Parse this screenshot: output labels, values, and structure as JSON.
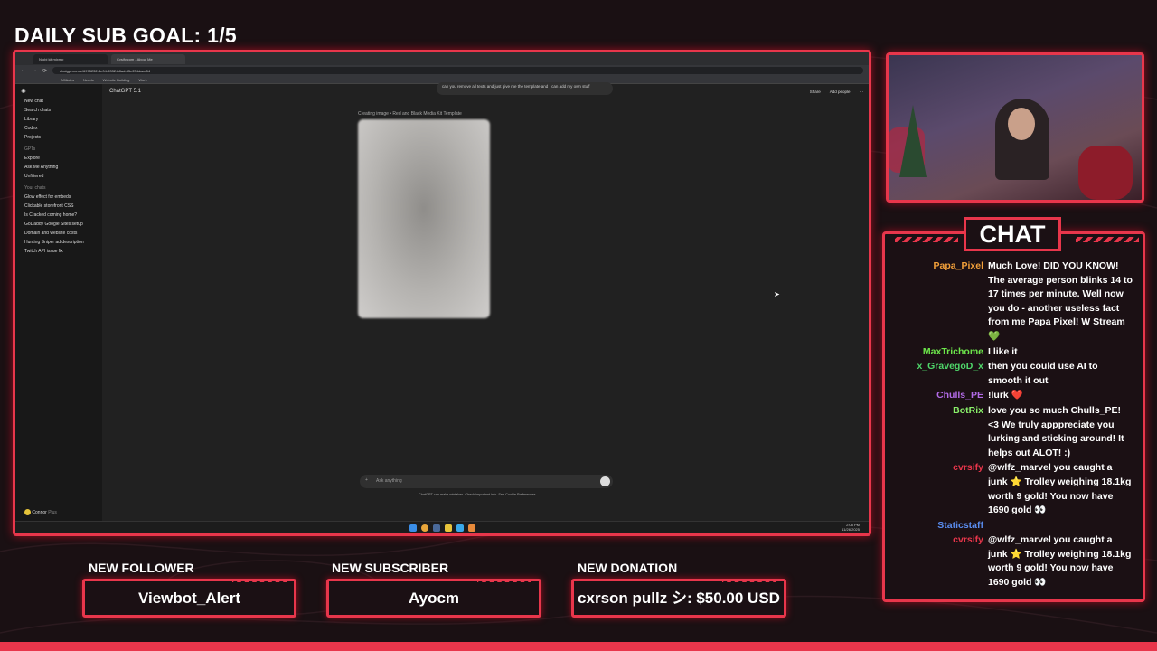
{
  "overlay": {
    "goal_text": "DAILY SUB GOAL: 1/5",
    "accent_color": "#e8364b",
    "chat_title": "CHAT"
  },
  "browser": {
    "tabs": [
      "Ntobi kit mixmp",
      "Cvsify.com - About Me"
    ],
    "url": "chatgpt.com/c/6975232-3e04-8332-b8ad-d5e234dace54",
    "bookmarks": [
      "Affiliates",
      "Needs",
      "Website Building",
      "Work"
    ]
  },
  "chatgpt": {
    "model": "ChatGPT 5.1",
    "share_label": "Share",
    "add_people_label": "Add people",
    "nav": [
      "New chat",
      "Search chats",
      "Library",
      "Codex",
      "Projects"
    ],
    "gpts_label": "GPTs",
    "gpts": [
      "Explore",
      "Ask Me Anything",
      "Unfiltered"
    ],
    "chats_label": "Your chats",
    "chats": [
      "Glow effect for embeds",
      "Clickable storefront CSS",
      "Is Cracked coming home?",
      "GoDaddy Google Sites setup",
      "Domain and website costs",
      "Hunting Sniper ad description",
      "Twitch API issue fix"
    ],
    "user": "Connor",
    "user_plan": "Plus",
    "bubble_text": "can you remove all texts and just give me the template and I can add my own stuff",
    "creating_text": "Creating image • Red and Black Media Kit Template",
    "ask_placeholder": "Ask anything",
    "disclaimer": "ChatGPT can make mistakes. Check important info. See Cookie Preferences.",
    "clock": "2:08 PM",
    "date": "11/26/2025"
  },
  "chat_messages": [
    {
      "user": "Papa_Pixel",
      "color": "#f3a03a",
      "text": "Much Love! DID YOU KNOW! The average person blinks 14 to 17 times per minute. Well now you do - another useless fact from me Papa Pixel! W Stream 💚"
    },
    {
      "user": "MaxTrichome",
      "color": "#6de64b",
      "text": "I like it"
    },
    {
      "user": "x_GravegoD_x",
      "color": "#4fd66a",
      "text": "then you could use AI to smooth it out"
    },
    {
      "user": "Chulls_PE",
      "color": "#b36be8",
      "text": "!lurk ❤️"
    },
    {
      "user": "BotRix",
      "color": "#8af06a",
      "text": "love you so much Chulls_PE! <3 We truly apppreciate you lurking and sticking around! It helps out ALOT! :)"
    },
    {
      "user": "cvrsify",
      "color": "#e8364b",
      "text": "@wlfz_marvel you caught a junk ⭐ Trolley weighing 18.1kg worth 9 gold! You now have 1690 gold 👀"
    },
    {
      "user": "Staticstaff",
      "color": "#5a8df0",
      "text": ""
    },
    {
      "user": "cvrsify",
      "color": "#e8364b",
      "text": "@wlfz_marvel you caught a junk ⭐ Trolley weighing 18.1kg worth 9 gold! You now have 1690 gold 👀"
    }
  ],
  "alerts": {
    "follower_label": "NEW FOLLOWER",
    "follower_name": "Viewbot_Alert",
    "subscriber_label": "NEW SUBSCRIBER",
    "subscriber_name": "Ayocm",
    "donation_label": "NEW DONATION",
    "donation_text": "cxrson pullz シ: $50.00 USD"
  }
}
